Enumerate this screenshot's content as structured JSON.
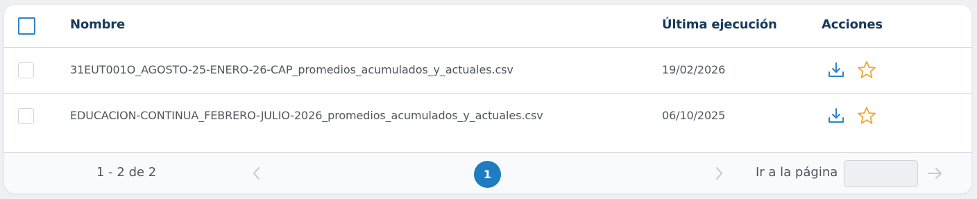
{
  "table": {
    "headers": {
      "name": "Nombre",
      "last_run": "Última ejecución",
      "actions": "Acciones"
    },
    "rows": [
      {
        "name": "31EUT001O_AGOSTO-25-ENERO-26-CAP_promedios_acumulados_y_actuales.csv",
        "last_run": "19/02/2026",
        "actions": [
          "download-icon",
          "star-icon"
        ]
      },
      {
        "name": "EDUCACION-CONTINUA_FEBRERO-JULIO-2026_promedios_acumulados_y_actuales.csv",
        "last_run": "06/10/2025",
        "actions": [
          "download-icon",
          "star-icon"
        ]
      }
    ]
  },
  "pagination": {
    "range": "1 - 2 de 2",
    "current_page": "1",
    "goto_label": "Ir a la página",
    "goto_value": "",
    "icons": [
      "chevron-left-icon",
      "chevron-right-icon",
      "arrow-right-icon"
    ]
  },
  "colors": {
    "header_text": "#173a5c",
    "accent_blue": "#1f7cc1",
    "download_icon": "#2d84c6",
    "star_icon": "#f3a62b",
    "muted": "#c4c9cf"
  }
}
